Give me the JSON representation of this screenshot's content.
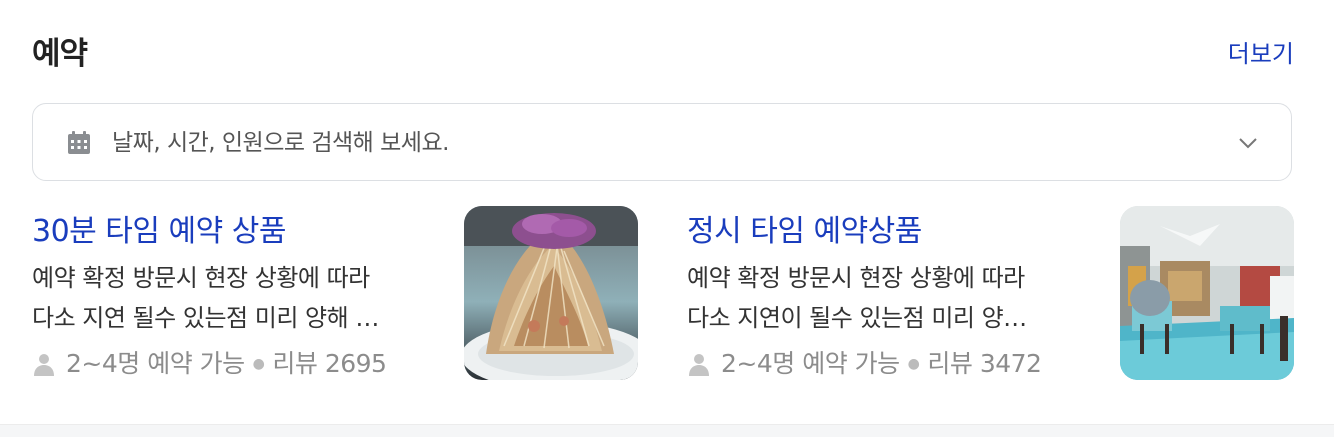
{
  "section": {
    "title": "예약",
    "more_label": "더보기"
  },
  "search": {
    "placeholder": "날짜, 시간, 인원으로 검색해 보세요."
  },
  "cards": [
    {
      "title": "30분 타임 예약 상품",
      "desc_line1": "예약 확정 방문시 현장 상황에 따라",
      "desc_line2": "다소 지연 될수 있는점 미리 양해 …",
      "capacity": "2~4명 예약 가능",
      "reviews": "리뷰 2695",
      "image": "food-noodle-salad-photo"
    },
    {
      "title": "정시 타임 예약상품",
      "desc_line1": "예약 확정 방문시 현장 상황에 따라",
      "desc_line2": "다소 지연이 될수 있는점 미리 양…",
      "capacity": "2~4명 예약 가능",
      "reviews": "리뷰 3472",
      "image": "restaurant-interior-photo"
    }
  ],
  "colors": {
    "link": "#1a3dbd",
    "meta": "#8c8c8c",
    "border": "#dcdfe3"
  }
}
